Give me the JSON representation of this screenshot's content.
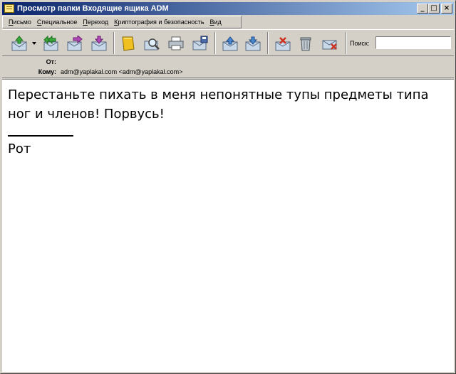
{
  "window": {
    "title": "Просмотр папки Входящие ящика ADM",
    "minimize": "_",
    "maximize": "□",
    "close": "×"
  },
  "menu": [
    {
      "label": "Письмо",
      "accel": "П",
      "rest": "исьмо"
    },
    {
      "label": "Специальное",
      "accel": "С",
      "rest": "пециальное"
    },
    {
      "label": "Переход",
      "accel": "П",
      "rest": "ереход"
    },
    {
      "label": "Криптография и безопасность",
      "accel": "К",
      "rest": "риптография и безопасность"
    },
    {
      "label": "Вид",
      "accel": "В",
      "rest": "ид"
    }
  ],
  "toolbar": {
    "icons": [
      "get-mail-icon",
      "reply-all-icon",
      "forward-icon",
      "new-message-icon",
      "address-book-icon",
      "find-icon",
      "print-icon",
      "save-icon",
      "previous-icon",
      "next-icon",
      "mark-icon",
      "delete-icon",
      "junk-icon"
    ],
    "search_label": "Поиск:",
    "search_value": ""
  },
  "header": {
    "from_label": "От:",
    "from_value": "",
    "to_label": "Кому:",
    "to_value": "adm@yaplakal.com <adm@yaplakal.com>"
  },
  "message": {
    "body": "Перестаньте пихать в меня непонятные тупы предметы типа ног и членов! Порвусь!",
    "signature": "Рот"
  },
  "colors": {
    "titlebar_start": "#0a246a",
    "titlebar_end": "#a6caf0",
    "chrome": "#d4d0c8",
    "body_bg": "#ffffff"
  }
}
